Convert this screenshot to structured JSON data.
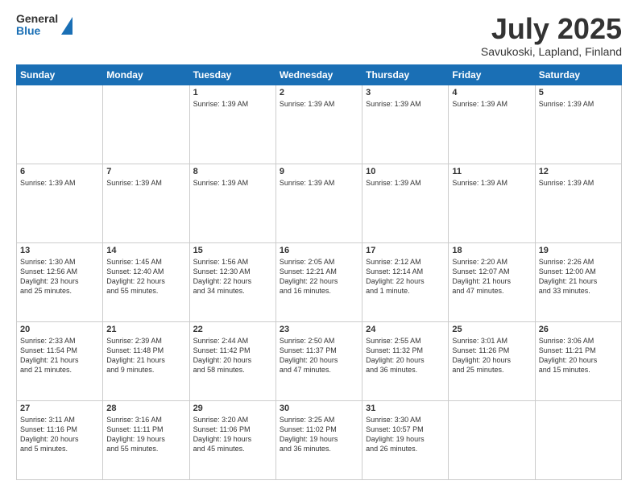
{
  "header": {
    "logo": {
      "general": "General",
      "blue": "Blue"
    },
    "title": "July 2025",
    "location": "Savukoski, Lapland, Finland"
  },
  "weekdays": [
    "Sunday",
    "Monday",
    "Tuesday",
    "Wednesday",
    "Thursday",
    "Friday",
    "Saturday"
  ],
  "weeks": [
    [
      {
        "day": "",
        "lines": []
      },
      {
        "day": "",
        "lines": []
      },
      {
        "day": "1",
        "lines": [
          "Sunrise: 1:39 AM"
        ]
      },
      {
        "day": "2",
        "lines": [
          "Sunrise: 1:39 AM"
        ]
      },
      {
        "day": "3",
        "lines": [
          "Sunrise: 1:39 AM"
        ]
      },
      {
        "day": "4",
        "lines": [
          "Sunrise: 1:39 AM"
        ]
      },
      {
        "day": "5",
        "lines": [
          "Sunrise: 1:39 AM"
        ]
      }
    ],
    [
      {
        "day": "6",
        "lines": [
          "Sunrise: 1:39 AM"
        ]
      },
      {
        "day": "7",
        "lines": [
          "Sunrise: 1:39 AM"
        ]
      },
      {
        "day": "8",
        "lines": [
          "Sunrise: 1:39 AM"
        ]
      },
      {
        "day": "9",
        "lines": [
          "Sunrise: 1:39 AM"
        ]
      },
      {
        "day": "10",
        "lines": [
          "Sunrise: 1:39 AM"
        ]
      },
      {
        "day": "11",
        "lines": [
          "Sunrise: 1:39 AM"
        ]
      },
      {
        "day": "12",
        "lines": [
          "Sunrise: 1:39 AM"
        ]
      }
    ],
    [
      {
        "day": "13",
        "lines": [
          "Sunrise: 1:30 AM",
          "Sunset: 12:56 AM",
          "Daylight: 23 hours",
          "and 25 minutes."
        ]
      },
      {
        "day": "14",
        "lines": [
          "Sunrise: 1:45 AM",
          "Sunset: 12:40 AM",
          "Daylight: 22 hours",
          "and 55 minutes."
        ]
      },
      {
        "day": "15",
        "lines": [
          "Sunrise: 1:56 AM",
          "Sunset: 12:30 AM",
          "Daylight: 22 hours",
          "and 34 minutes."
        ]
      },
      {
        "day": "16",
        "lines": [
          "Sunrise: 2:05 AM",
          "Sunset: 12:21 AM",
          "Daylight: 22 hours",
          "and 16 minutes."
        ]
      },
      {
        "day": "17",
        "lines": [
          "Sunrise: 2:12 AM",
          "Sunset: 12:14 AM",
          "Daylight: 22 hours",
          "and 1 minute."
        ]
      },
      {
        "day": "18",
        "lines": [
          "Sunrise: 2:20 AM",
          "Sunset: 12:07 AM",
          "Daylight: 21 hours",
          "and 47 minutes."
        ]
      },
      {
        "day": "19",
        "lines": [
          "Sunrise: 2:26 AM",
          "Sunset: 12:00 AM",
          "Daylight: 21 hours",
          "and 33 minutes."
        ]
      }
    ],
    [
      {
        "day": "20",
        "lines": [
          "Sunrise: 2:33 AM",
          "Sunset: 11:54 PM",
          "Daylight: 21 hours",
          "and 21 minutes."
        ]
      },
      {
        "day": "21",
        "lines": [
          "Sunrise: 2:39 AM",
          "Sunset: 11:48 PM",
          "Daylight: 21 hours",
          "and 9 minutes."
        ]
      },
      {
        "day": "22",
        "lines": [
          "Sunrise: 2:44 AM",
          "Sunset: 11:42 PM",
          "Daylight: 20 hours",
          "and 58 minutes."
        ]
      },
      {
        "day": "23",
        "lines": [
          "Sunrise: 2:50 AM",
          "Sunset: 11:37 PM",
          "Daylight: 20 hours",
          "and 47 minutes."
        ]
      },
      {
        "day": "24",
        "lines": [
          "Sunrise: 2:55 AM",
          "Sunset: 11:32 PM",
          "Daylight: 20 hours",
          "and 36 minutes."
        ]
      },
      {
        "day": "25",
        "lines": [
          "Sunrise: 3:01 AM",
          "Sunset: 11:26 PM",
          "Daylight: 20 hours",
          "and 25 minutes."
        ]
      },
      {
        "day": "26",
        "lines": [
          "Sunrise: 3:06 AM",
          "Sunset: 11:21 PM",
          "Daylight: 20 hours",
          "and 15 minutes."
        ]
      }
    ],
    [
      {
        "day": "27",
        "lines": [
          "Sunrise: 3:11 AM",
          "Sunset: 11:16 PM",
          "Daylight: 20 hours",
          "and 5 minutes."
        ]
      },
      {
        "day": "28",
        "lines": [
          "Sunrise: 3:16 AM",
          "Sunset: 11:11 PM",
          "Daylight: 19 hours",
          "and 55 minutes."
        ]
      },
      {
        "day": "29",
        "lines": [
          "Sunrise: 3:20 AM",
          "Sunset: 11:06 PM",
          "Daylight: 19 hours",
          "and 45 minutes."
        ]
      },
      {
        "day": "30",
        "lines": [
          "Sunrise: 3:25 AM",
          "Sunset: 11:02 PM",
          "Daylight: 19 hours",
          "and 36 minutes."
        ]
      },
      {
        "day": "31",
        "lines": [
          "Sunrise: 3:30 AM",
          "Sunset: 10:57 PM",
          "Daylight: 19 hours",
          "and 26 minutes."
        ]
      },
      {
        "day": "",
        "lines": []
      },
      {
        "day": "",
        "lines": []
      }
    ]
  ]
}
